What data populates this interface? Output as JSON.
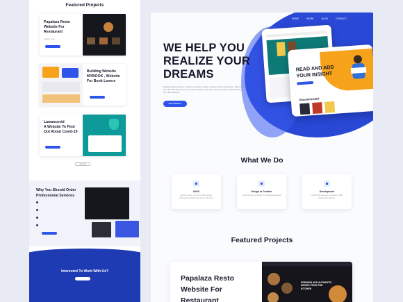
{
  "left": {
    "featured_title": "Featured Projects",
    "cards": [
      {
        "title_lines": [
          "Papalaza Resto",
          "Website For",
          "Restaurant"
        ],
        "sub": "Landing page"
      },
      {
        "title_lines": [
          "Building Website",
          "MYBOOK , Website",
          "For Book Lovers"
        ],
        "sub": "Landing page"
      },
      {
        "title_lines": [
          "Lawancovid",
          "A Website To Find",
          "Out About Covid-19"
        ],
        "sub": "Landing page"
      }
    ],
    "view_all": "View All",
    "why_title_lines": [
      "Why You Should Order",
      "Professional Services"
    ],
    "interest": "Interested To Work With Us?"
  },
  "nav": {
    "items": [
      "HOME",
      "WORK",
      "BLOG",
      "CONTACT"
    ]
  },
  "hero": {
    "headline_lines": [
      "WE HELP YOU",
      "REALIZE YOUR",
      "DREAMS"
    ],
    "body": "Digital design services, including website creation, startups and mobile apps. Each variety, we will make the process of product design easy and make it possible. We'll develop for the most startups",
    "button": "LET'S TALK !",
    "mockup_head_lines": [
      "READ AND ADD",
      "YOUR INSIGHT"
    ],
    "mockup_section": "Recommended"
  },
  "services": {
    "title": "What We Do",
    "items": [
      {
        "name": "UI/UX",
        "desc": "Landing Pages, User Flow, Wireframing, Prototyping, Mobile App Design, Web App"
      },
      {
        "name": "Design to Creative",
        "desc": "Visual Identity, Animation, Ad, Marketing Material"
      },
      {
        "name": "Development",
        "desc": "HTML/CSS JavaScript, Animation, PHP, Responsive Website"
      }
    ]
  },
  "projects": {
    "title": "Featured Projects",
    "first_title_lines": [
      "Papalaza Resto",
      "Website For",
      "Restaurant"
    ],
    "thumb_text_lines": [
      "PREMIUM AND AUTHENTIC",
      "DISHES FROM THE",
      "KITCHEN"
    ]
  }
}
